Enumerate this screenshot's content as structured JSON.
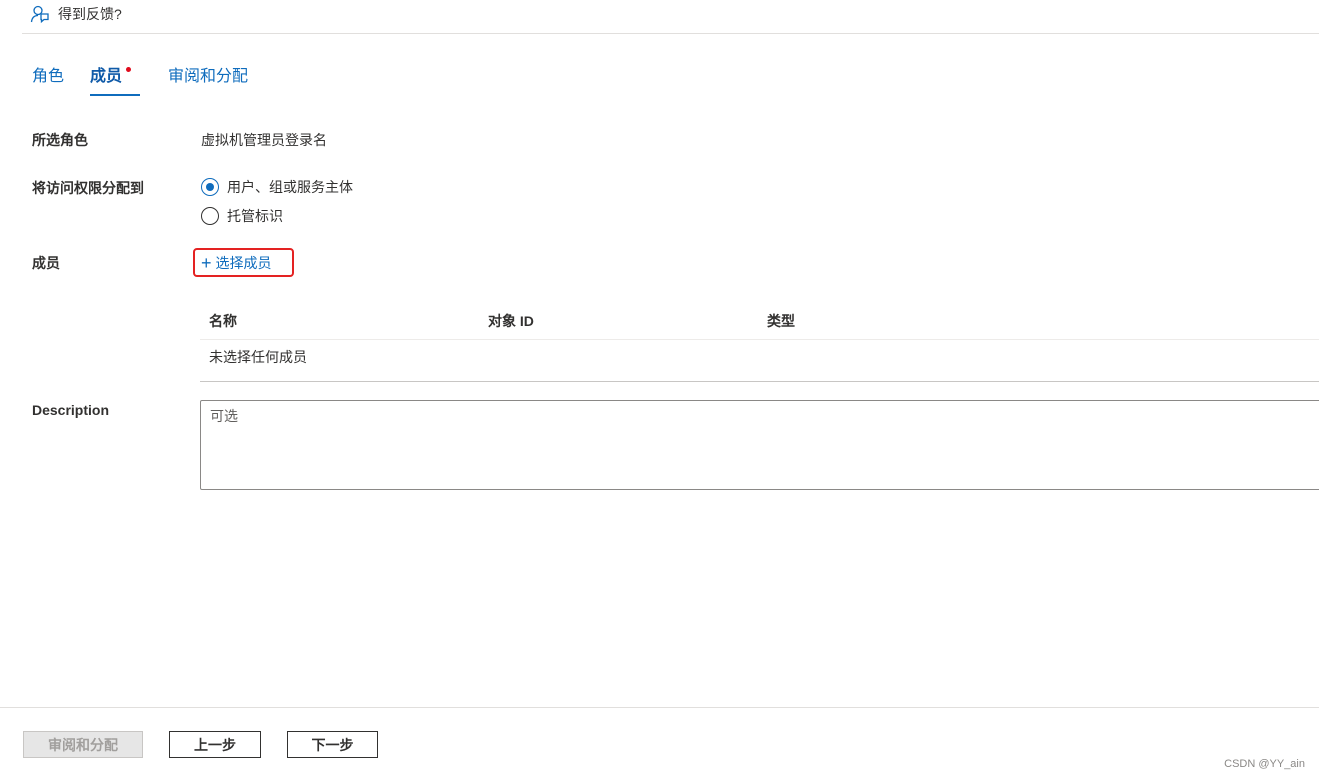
{
  "feedback": {
    "label": "得到反馈?"
  },
  "tabs": [
    {
      "label": "角色"
    },
    {
      "label": "成员"
    },
    {
      "label": "审阅和分配"
    }
  ],
  "form": {
    "selected_role": {
      "label": "所选角色",
      "value": "虚拟机管理员登录名"
    },
    "assign_access": {
      "label": "将访问权限分配到",
      "options": [
        {
          "label": "用户、组或服务主体",
          "checked": true
        },
        {
          "label": "托管标识",
          "checked": false
        }
      ]
    },
    "members": {
      "label": "成员",
      "select_label": "选择成员",
      "table": {
        "headers": [
          "名称",
          "对象 ID",
          "类型"
        ],
        "empty_text": "未选择任何成员"
      }
    },
    "description": {
      "label": "Description",
      "placeholder": "可选"
    }
  },
  "footer": {
    "review_label": "审阅和分配",
    "prev_label": "上一步",
    "next_label": "下一步"
  },
  "watermark": "CSDN @YY_ain",
  "colors": {
    "accent": "#0f6cbd",
    "highlight_border": "#e42222",
    "required_dot": "#e00b1c"
  }
}
